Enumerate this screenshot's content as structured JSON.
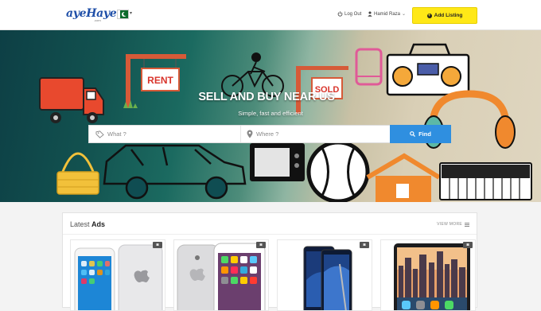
{
  "header": {
    "logo_text": "ayeHaye",
    "logo_sub": ".com",
    "logout_label": "Log Out",
    "user_name": "Hamid Raza",
    "add_listing_label": "Add Listing"
  },
  "hero": {
    "title": "SELL AND BUY NEAR US",
    "subtitle": "Simple, fast and efficient",
    "sign_rent": "RENT",
    "sign_sold": "SOLD"
  },
  "search": {
    "what_placeholder": "What ?",
    "where_placeholder": "Where ?",
    "find_label": "Find"
  },
  "latest": {
    "title_light": "Latest",
    "title_bold": "Ads",
    "view_more": "VIEW MORE",
    "cards": [
      {
        "product": "iphone-white-and-silver"
      },
      {
        "product": "iphone-silver-back-and-front"
      },
      {
        "product": "samsung-note-and-pen"
      },
      {
        "product": "ipad-city-wallpaper"
      }
    ]
  },
  "colors": {
    "accent_yellow": "#ffe817",
    "find_blue": "#2f8fe0",
    "logo_blue": "#1f4fa8"
  }
}
